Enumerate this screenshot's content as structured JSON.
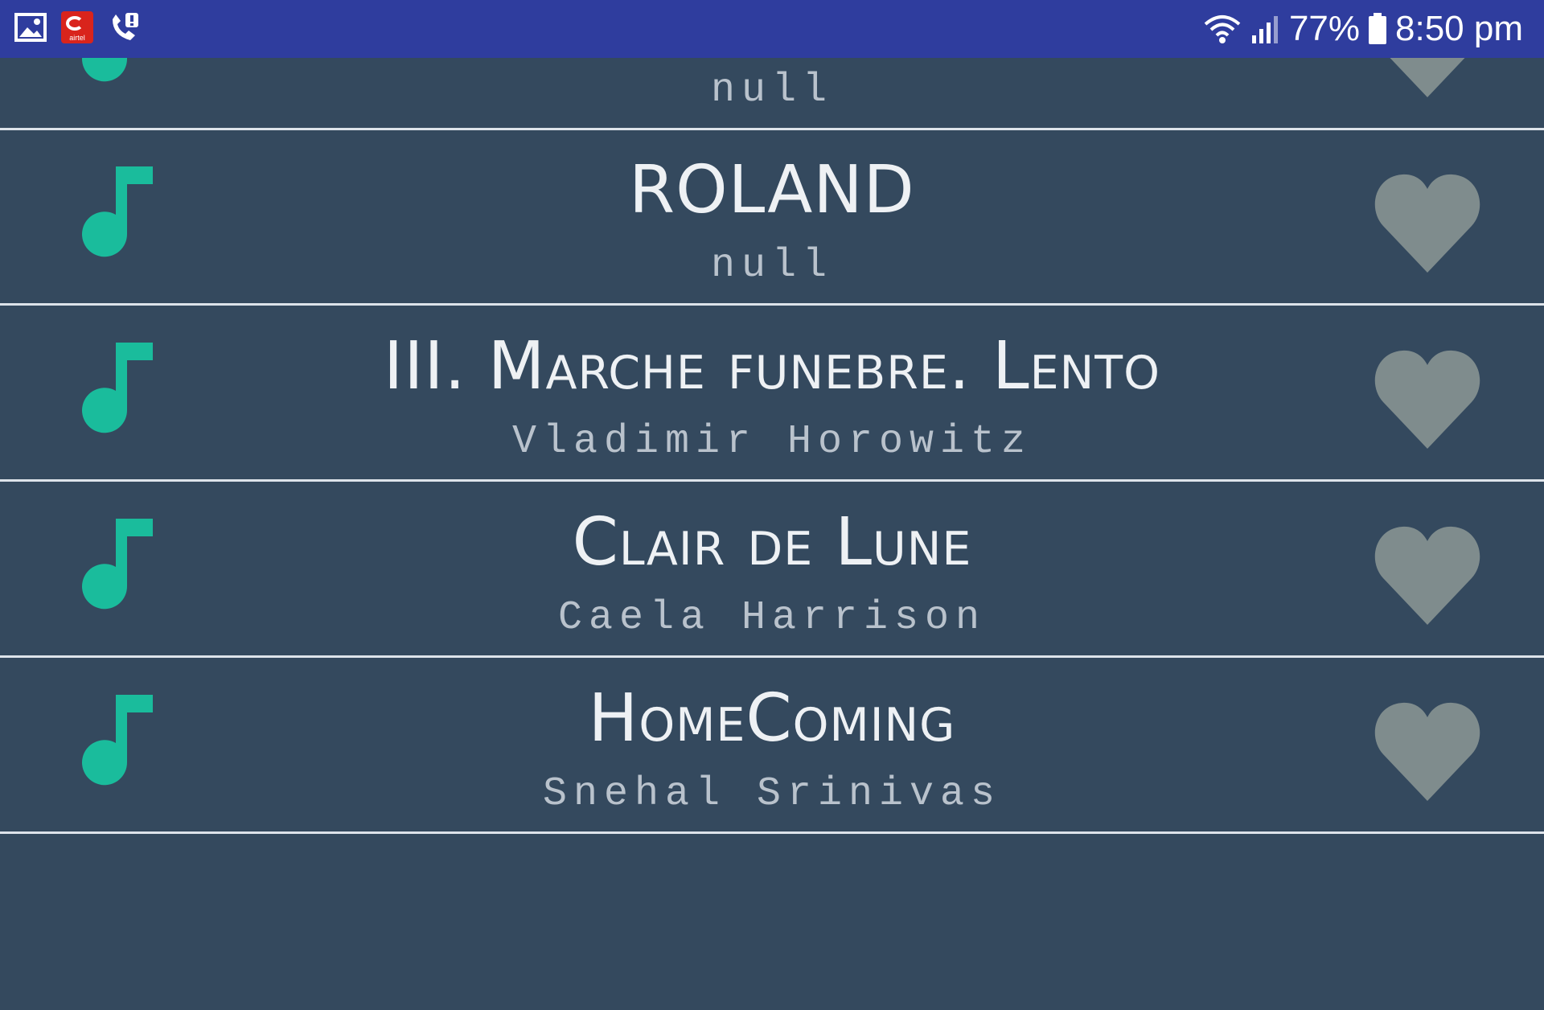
{
  "status_bar": {
    "left_icons": [
      "gallery-icon",
      "airtel-icon",
      "call-alert-icon"
    ],
    "carrier_icon_text": "airtel",
    "battery_percent": "77%",
    "time": "8:50 pm",
    "colors": {
      "background": "#2f3d9e"
    }
  },
  "colors": {
    "list_background": "#34495e",
    "note_icon": "#1abc9c",
    "heart_icon": "#7f8c8d",
    "divider": "#dde3ea"
  },
  "songs": [
    {
      "title": "",
      "artist": "null"
    },
    {
      "title": "ROLAND",
      "artist": "null"
    },
    {
      "title": "III. Marche funebre. Lento",
      "artist": "Vladimir Horowitz"
    },
    {
      "title": "Clair de Lune",
      "artist": "Caela Harrison"
    },
    {
      "title": "HomeComing",
      "artist": "Snehal Srinivas"
    },
    {
      "title": "",
      "artist": ""
    }
  ]
}
